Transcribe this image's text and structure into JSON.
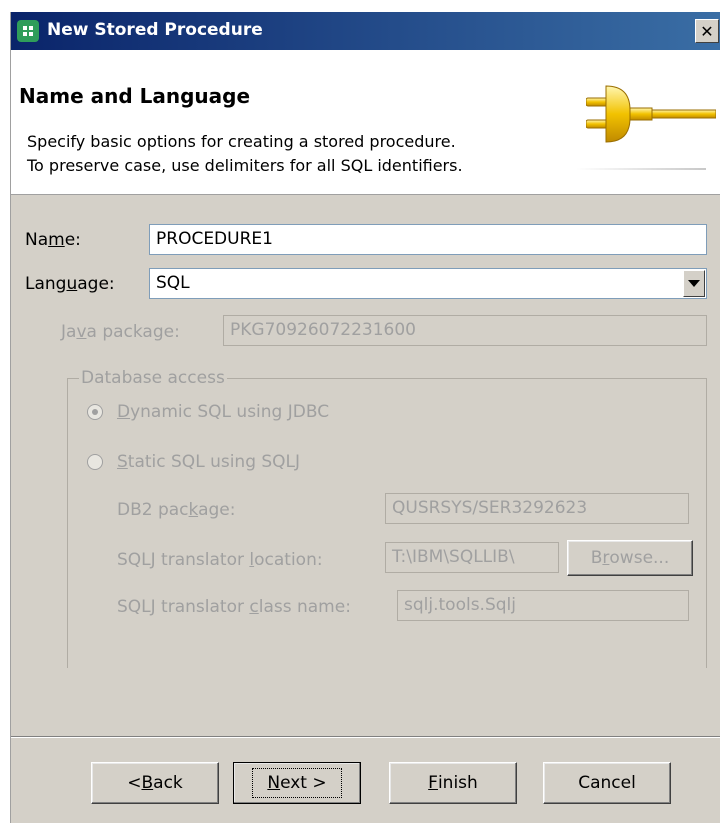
{
  "window": {
    "title": "New Stored Procedure",
    "close_label": "✕"
  },
  "header": {
    "title": "Name and Language",
    "description_line1": "Specify basic options for creating a stored procedure.",
    "description_line2": "To preserve case, use delimiters for all SQL identifiers."
  },
  "form": {
    "name": {
      "label_pre": "Na",
      "label_mnemonic": "m",
      "label_post": "e:",
      "value": "PROCEDURE1"
    },
    "language": {
      "label_pre": "Lang",
      "label_mnemonic": "u",
      "label_post": "age:",
      "value": "SQL"
    },
    "java_package": {
      "label_pre": "Ja",
      "label_mnemonic": "v",
      "label_post": "a package:",
      "value": "PKG70926072231600"
    },
    "database_access": {
      "legend": "Database access",
      "dynamic": {
        "label_mnemonic": "D",
        "label_post": "ynamic SQL using JDBC",
        "checked": true
      },
      "static": {
        "label_mnemonic": "S",
        "label_post": "tatic SQL using SQLJ",
        "checked": false
      },
      "db2_package": {
        "label_pre": "DB2 pac",
        "label_mnemonic": "k",
        "label_post": "age:",
        "value": "QUSRSYS/SER3292623"
      },
      "translator_location": {
        "label_pre": "SQLJ translator ",
        "label_mnemonic": "l",
        "label_post": "ocation:",
        "value": "T:\\IBM\\SQLLIB\\"
      },
      "browse": {
        "label_pre": "B",
        "label_mnemonic": "r",
        "label_post": "owse..."
      },
      "translator_class": {
        "label_pre": "SQLJ translator ",
        "label_mnemonic": "c",
        "label_post": "lass name:",
        "value": "sqlj.tools.Sqlj"
      }
    }
  },
  "buttons": {
    "back": {
      "pre": "< ",
      "mnemonic": "B",
      "post": "ack"
    },
    "next": {
      "mnemonic": "N",
      "post": "ext >"
    },
    "finish": {
      "mnemonic": "F",
      "post": "inish"
    },
    "cancel": "Cancel"
  },
  "colors": {
    "titlebar_start": "#0a246a",
    "titlebar_end": "#3a6ea5",
    "dialog_bg": "#d4d0c8",
    "disabled_text": "#a0a0a0"
  },
  "icons": [
    "app-icon",
    "close-icon",
    "plug-icon",
    "dropdown-arrow-icon"
  ]
}
